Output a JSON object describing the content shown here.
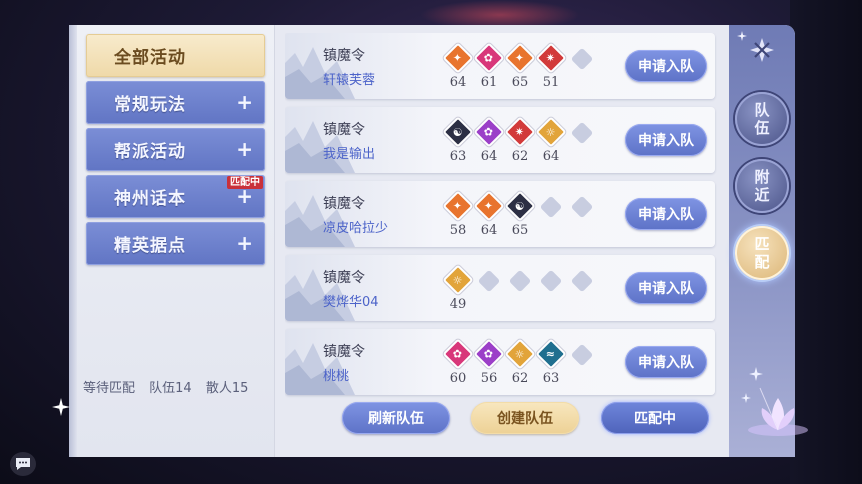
{
  "sidebar": {
    "categories": [
      {
        "label": "全部活动",
        "active": true
      },
      {
        "label": "常规玩法",
        "icon": "plus-icon"
      },
      {
        "label": "帮派活动",
        "icon": "plus-icon"
      },
      {
        "label": "神州话本",
        "icon": "plus-icon",
        "badge": "匹配中"
      },
      {
        "label": "精英据点",
        "icon": "plus-icon"
      }
    ],
    "stats": {
      "waiting": "等待匹配",
      "teams": "队伍14",
      "solo": "散人15"
    }
  },
  "teams": [
    {
      "activity": "镇魔令",
      "leader": "轩辕芙蓉",
      "members": [
        {
          "level": "64",
          "icon": "flame-emblem-icon",
          "color": "#e8742e"
        },
        {
          "level": "61",
          "icon": "lotus-emblem-icon",
          "color": "#d8377a"
        },
        {
          "level": "65",
          "icon": "flame-emblem-icon",
          "color": "#e8742e"
        },
        {
          "level": "51",
          "icon": "star-emblem-icon",
          "color": "#d23a3a"
        }
      ],
      "empty_slots": 1,
      "join_label": "申请入队"
    },
    {
      "activity": "镇魔令",
      "leader": "我是输出",
      "members": [
        {
          "level": "63",
          "icon": "yinyang-emblem-icon",
          "color": "#2c2f44"
        },
        {
          "level": "64",
          "icon": "lotus-emblem-icon",
          "color": "#9b3fc8"
        },
        {
          "level": "62",
          "icon": "star-emblem-icon",
          "color": "#d23a3a"
        },
        {
          "level": "64",
          "icon": "sun-emblem-icon",
          "color": "#e2a43a"
        }
      ],
      "empty_slots": 1,
      "join_label": "申请入队"
    },
    {
      "activity": "镇魔令",
      "leader": "凉皮哈拉少",
      "members": [
        {
          "level": "58",
          "icon": "flame-emblem-icon",
          "color": "#e8742e"
        },
        {
          "level": "64",
          "icon": "flame-emblem-icon",
          "color": "#e8742e"
        },
        {
          "level": "65",
          "icon": "yinyang-emblem-icon",
          "color": "#2c2f44"
        }
      ],
      "empty_slots": 2,
      "join_label": "申请入队"
    },
    {
      "activity": "镇魔令",
      "leader": "樊烨华04",
      "members": [
        {
          "level": "49",
          "icon": "sun-emblem-icon",
          "color": "#e2a43a"
        }
      ],
      "empty_slots": 4,
      "join_label": "申请入队"
    },
    {
      "activity": "镇魔令",
      "leader": "桃桃",
      "members": [
        {
          "level": "60",
          "icon": "lotus-emblem-icon",
          "color": "#d8377a"
        },
        {
          "level": "56",
          "icon": "lotus-emblem-icon",
          "color": "#9b3fc8"
        },
        {
          "level": "62",
          "icon": "sun-emblem-icon",
          "color": "#e2a43a"
        },
        {
          "level": "63",
          "icon": "wave-emblem-icon",
          "color": "#1f6f8f"
        }
      ],
      "empty_slots": 1,
      "join_label": "申请入队"
    }
  ],
  "footer": {
    "refresh": "刷新队伍",
    "create": "创建队伍",
    "matching": "匹配中"
  },
  "rail": {
    "team": "队伍",
    "nearby": "附近",
    "match": "匹配",
    "close_icon": "close-icon"
  },
  "colors": {
    "accent_blue": "#6478cc",
    "accent_gold": "#efd9a8",
    "badge_red": "#c9313a"
  }
}
